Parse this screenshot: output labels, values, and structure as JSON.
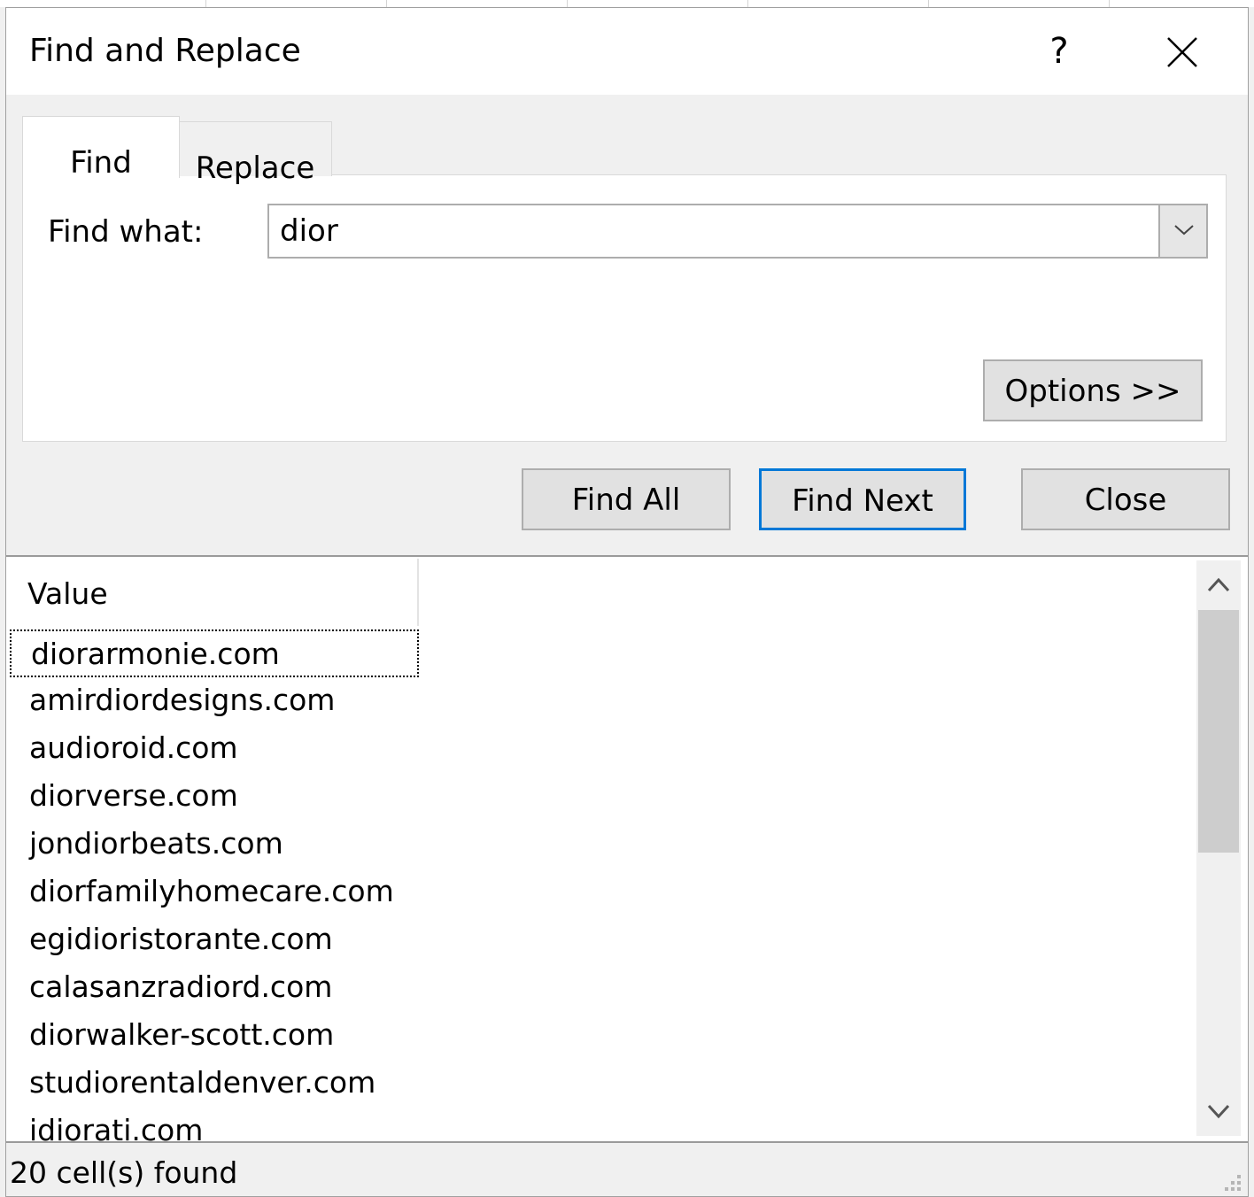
{
  "dialog": {
    "title": "Find and Replace",
    "help_icon": "?",
    "icons": [
      "help-icon",
      "close-icon",
      "chevron-down-icon",
      "scroll-up-icon",
      "scroll-down-icon",
      "resize-grip-icon"
    ]
  },
  "tabs": [
    {
      "label": "Find",
      "active": true
    },
    {
      "label": "Replace",
      "active": false
    }
  ],
  "find": {
    "label": "Find what:",
    "value": "dior"
  },
  "buttons": {
    "options": "Options >>",
    "find_all": "Find All",
    "find_next": "Find Next",
    "close": "Close"
  },
  "results": {
    "column_header": "Value",
    "rows": [
      "diorarmonie.com",
      "amirdiordesigns.com",
      "audioroid.com",
      "diorverse.com",
      "jondiorbeats.com",
      "diorfamilyhomecare.com",
      "egidioristorante.com",
      "calasanzradiord.com",
      "diorwalker-scott.com",
      "studiorentaldenver.com",
      "idiorati.com"
    ]
  },
  "status": "20 cell(s) found",
  "colors": {
    "focus_border": "#0078d7",
    "dialog_bg": "#f0f0f0",
    "button_bg": "#e1e1e1"
  }
}
